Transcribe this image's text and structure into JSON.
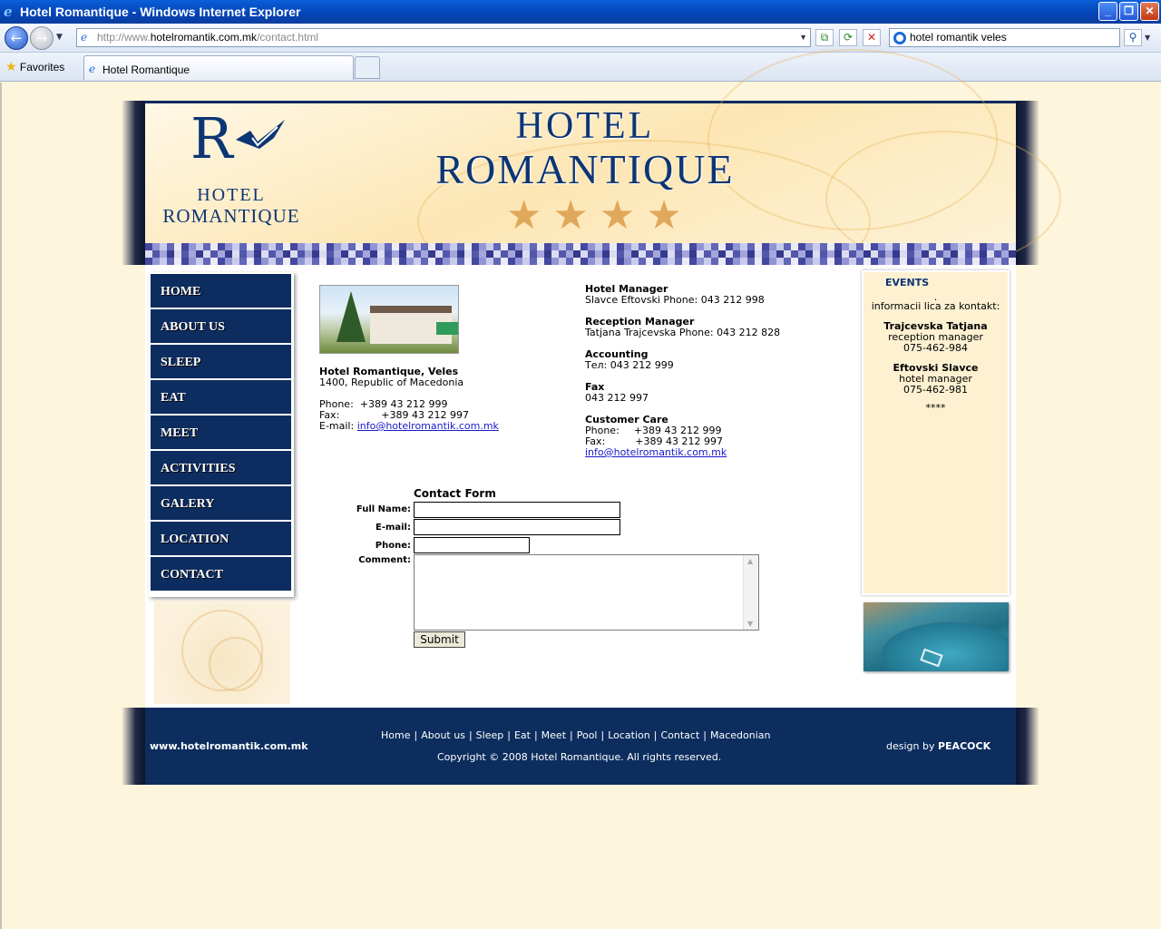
{
  "browser": {
    "window_title": "Hotel Romantique - Windows Internet Explorer",
    "address_prefix": "http://www.",
    "address_domain": "hotelromantik.com.mk",
    "address_path": "/contact.html",
    "search_text": "hotel romantik veles",
    "favorites_label": "Favorites",
    "tab_title": "Hotel Romantique"
  },
  "header": {
    "logo_letter": "R",
    "logo_line1": "HOTEL",
    "logo_line2": "ROMANTIQUE",
    "title_line1": "HOTEL",
    "title_line2": "ROMANTIQUE",
    "stars": "★★★★"
  },
  "nav": {
    "items": [
      {
        "label": "HOME"
      },
      {
        "label": "ABOUT US"
      },
      {
        "label": "SLEEP"
      },
      {
        "label": "EAT"
      },
      {
        "label": "MEET"
      },
      {
        "label": "ACTIVITIES"
      },
      {
        "label": "GALERY"
      },
      {
        "label": "LOCATION"
      },
      {
        "label": "CONTACT"
      }
    ]
  },
  "address": {
    "name": "Hotel Romantique, Veles",
    "city": "1400, Republic of Macedonia",
    "phone_label": "Phone:",
    "phone": "+389 43 212 999",
    "fax_label": "Fax:",
    "fax": "+389 43 212 997",
    "email_label": "E-mail:",
    "email": "info@hotelromantik.com.mk"
  },
  "contacts": {
    "manager_title": "Hotel Manager",
    "manager_line": "Slavce Eftovski Phone: 043 212 998",
    "reception_title": "Reception Manager",
    "reception_line": "Tatjana Trajcevska Phone: 043 212 828",
    "accounting_title": "Accounting",
    "accounting_line": "Тел: 043 212 999",
    "fax_title": "Fax",
    "fax_line": "043 212 997",
    "care_title": "Customer Care",
    "care_phone_label": "Phone:",
    "care_phone": "+389 43 212 999",
    "care_fax_label": "Fax:",
    "care_fax": "+389 43 212 997",
    "care_email": "info@hotelromantik.com.mk"
  },
  "form": {
    "title": "Contact Form",
    "fullname_label": "Full Name:",
    "email_label": "E-mail:",
    "phone_label": "Phone:",
    "comment_label": "Comment:",
    "submit_label": "Submit"
  },
  "events": {
    "title": "EVENTS",
    "dot": ".",
    "intro": "informacii lica za kontakt:",
    "person1_name": "Trajcevska Tatjana",
    "person1_role": "reception manager",
    "person1_phone": "075-462-984",
    "person2_name": "Eftovski Slavce",
    "person2_role": "hotel manager",
    "person2_phone": "075-462-981",
    "stars": "****"
  },
  "footer": {
    "site": "www.hotelromantik.com.mk",
    "links": [
      "Home",
      "About us",
      "Sleep",
      "Eat",
      "Meet",
      "Pool",
      "Location",
      "Contact",
      "Macedonian"
    ],
    "separator": "|",
    "copyright": "Copyright © 2008 Hotel Romantique. All rights reserved.",
    "design_prefix": "design by",
    "design_name": "PEACOCK"
  }
}
